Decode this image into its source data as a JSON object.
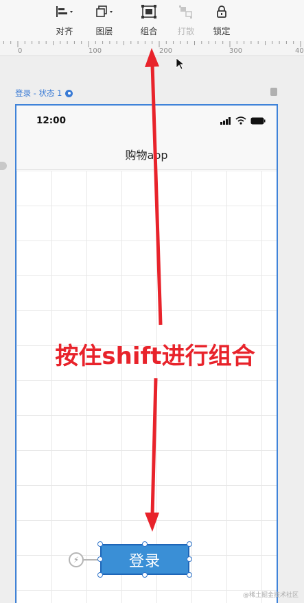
{
  "toolbar": {
    "items": [
      {
        "label": "对齐",
        "icon": "align-left-icon",
        "disabled": false
      },
      {
        "label": "图层",
        "icon": "layers-icon",
        "disabled": false
      },
      {
        "label": "组合",
        "icon": "group-icon",
        "disabled": false
      },
      {
        "label": "打散",
        "icon": "ungroup-icon",
        "disabled": true
      },
      {
        "label": "锁定",
        "icon": "lock-icon",
        "disabled": false
      }
    ]
  },
  "ruler": {
    "marks": [
      "0",
      "100",
      "200",
      "300",
      "40"
    ]
  },
  "artboard": {
    "label": "登录 - 状态 1"
  },
  "phone": {
    "time": "12:00",
    "title": "购物app",
    "login_button": "登录"
  },
  "annotation": {
    "text": "按住shift进行组合",
    "color": "#e8232b"
  },
  "watermark": "@稀土掘金技术社区",
  "colors": {
    "accent": "#3a8fd6",
    "frame": "#3f83d9",
    "annotation": "#e8232b"
  }
}
